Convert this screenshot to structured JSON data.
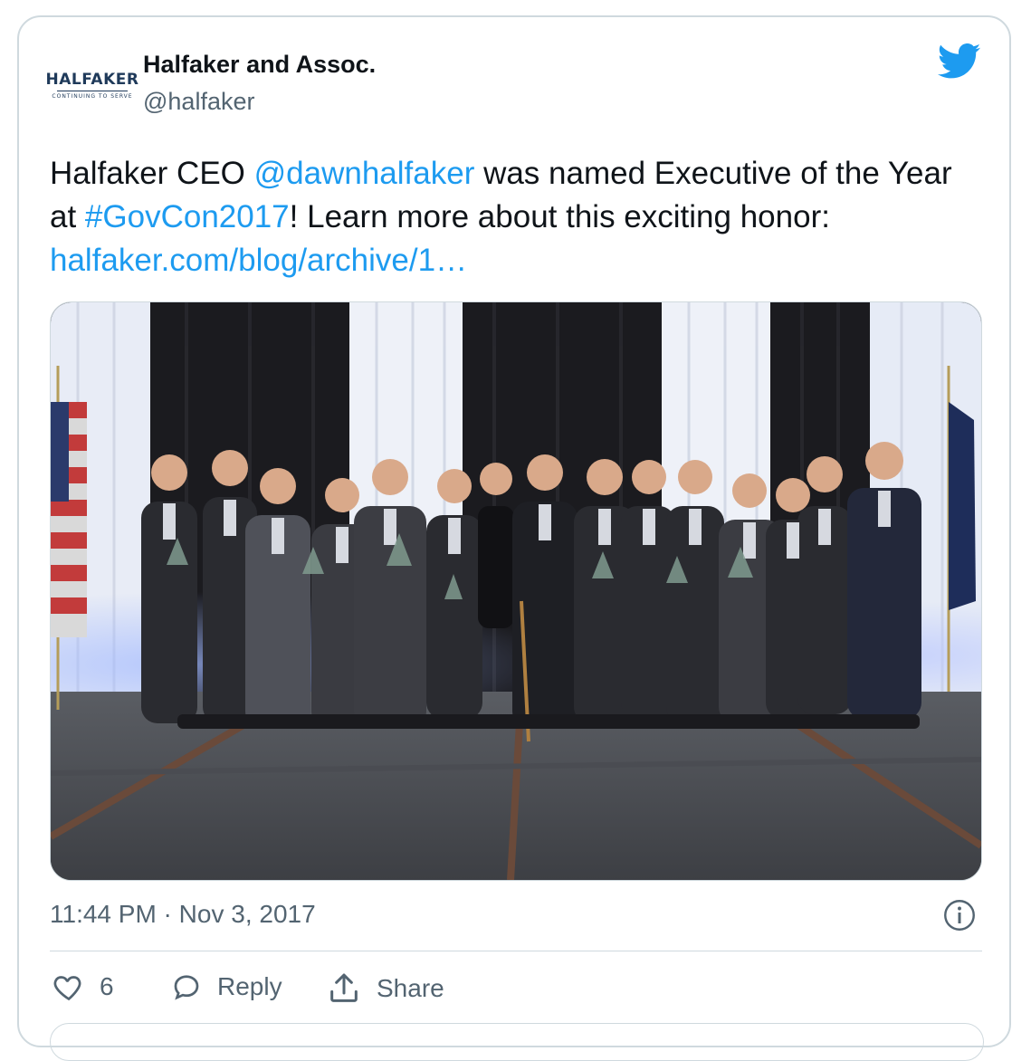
{
  "author": {
    "name": "Halfaker and Assoc.",
    "handle": "@halfaker",
    "logo_text": "HALFAKER",
    "logo_tagline": "CONTINUING TO SERVE"
  },
  "tweet": {
    "text_part1": "Halfaker CEO ",
    "mention": "@dawnhalfaker",
    "text_part2": " was named Executive of the Year at ",
    "hashtag": "#GovCon2017",
    "text_part3": "! Learn more about this exciting honor: ",
    "link": "halfaker.com/blog/archive/1…"
  },
  "meta": {
    "time": "11:44 PM",
    "separator": " · ",
    "date": "Nov 3, 2017"
  },
  "actions": {
    "like_count": "6",
    "reply_label": "Reply",
    "share_label": "Share"
  },
  "icons": {
    "brand": "twitter-bird-icon",
    "info": "info-icon",
    "like": "heart-icon",
    "reply": "speech-bubble-icon",
    "share": "share-upload-icon"
  },
  "colors": {
    "accent": "#1d9bf0",
    "text": "#0f1419",
    "secondary": "#536471",
    "border": "#cfd9de"
  }
}
